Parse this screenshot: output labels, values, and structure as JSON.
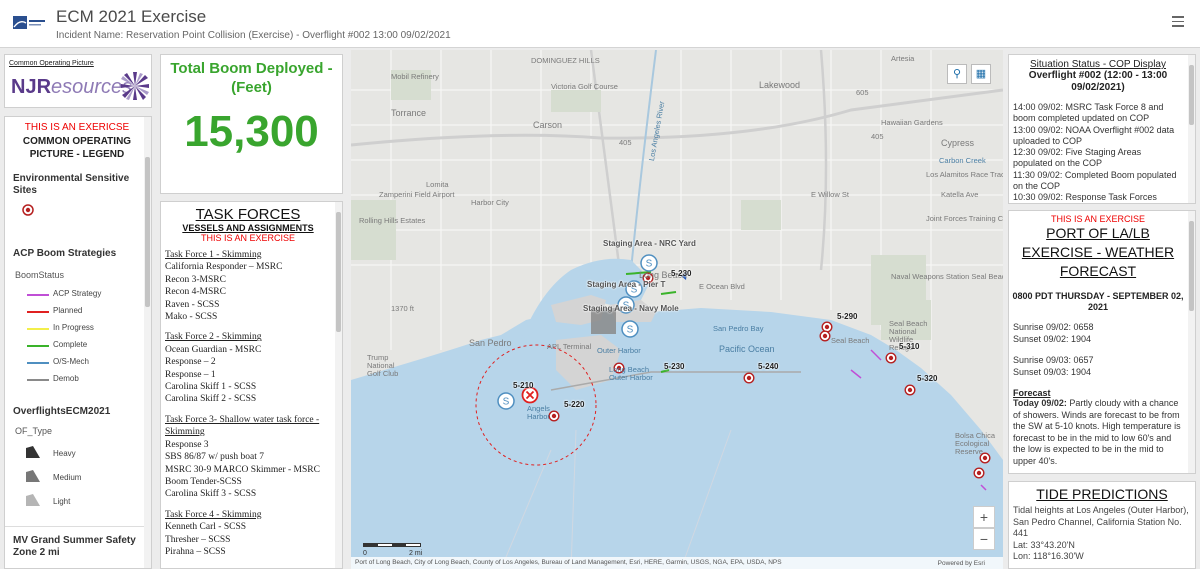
{
  "header": {
    "title": "ECM 2021 Exercise",
    "subtitle": "Incident Name: Reservation Point Collision (Exercise) - Overflight #002 13:00 09/02/2021"
  },
  "logo_panel": {
    "link": "Common Operating Picture",
    "brand_a": "NJR",
    "brand_b": "esources"
  },
  "legend": {
    "exercise_notice": "THIS IS AN EXERICSE",
    "title": "COMMON OPERATING PICTURE - LEGEND",
    "env_header": "Environmental Sensitive Sites",
    "acp_header": "ACP Boom Strategies",
    "boom_status_label": "BoomStatus",
    "boom_items": [
      {
        "label": "ACP Strategy",
        "color": "#c04fd6"
      },
      {
        "label": "Planned",
        "color": "#e02020"
      },
      {
        "label": "In Progress",
        "color": "#f3ef4a"
      },
      {
        "label": "Complete",
        "color": "#3ab32a"
      },
      {
        "label": "O/S-Mech",
        "color": "#4f8fc0"
      },
      {
        "label": "Demob",
        "color": "#8a8a8a"
      }
    ],
    "overflights_header": "OverflightsECM2021",
    "of_type_label": "OF_Type",
    "of_items": [
      {
        "label": "Heavy",
        "color": "#333333"
      },
      {
        "label": "Medium",
        "color": "#777777"
      },
      {
        "label": "Light",
        "color": "#b5b5b5"
      }
    ],
    "mv_header": "MV Grand Summer Safety Zone 2 mi"
  },
  "boom": {
    "title": "Total Boom Deployed - (Feet)",
    "value": "15,300"
  },
  "task_forces": {
    "title": "TASK FORCES",
    "subtitle": "VESSELS AND ASSIGNMENTS",
    "exercise_notice": "THIS IS AN EXERCISE",
    "groups": [
      {
        "name": "Task Force 1 - Skimming",
        "items": [
          "California Responder – MSRC",
          "Recon 3-MSRC",
          "Recon 4-MSRC",
          "Raven - SCSS",
          "Mako - SCSS"
        ]
      },
      {
        "name": "Task Force 2 - Skimming",
        "items": [
          "Ocean Guardian - MSRC",
          "Response – 2",
          "Response – 1",
          "Carolina Skiff 1 - SCSS",
          "Carolina Skiff 2 - SCSS"
        ]
      },
      {
        "name": "Task Force 3- Shallow water task force - Skimming",
        "items": [
          "Response 3",
          "SBS 86/87 w/ push boat 7",
          "MSRC 30-9 MARCO Skimmer - MSRC",
          "Boom Tender-SCSS",
          "Carolina Skiff 3 - SCSS"
        ]
      },
      {
        "name": "Task Force 4 - Skimming",
        "items": [
          "Kenneth Carl - SCSS",
          "Thresher – SCSS",
          "Pirahna – SCSS"
        ]
      }
    ]
  },
  "map": {
    "labels": {
      "dominguez": "DOMINGUEZ HILLS",
      "torrance": "Torrance",
      "mobil": "Mobil Refinery",
      "victoria": "Victoria Golf Course",
      "carson": "Carson",
      "lakewood": "Lakewood",
      "artesia": "Artesia",
      "hawaiian": "Hawaiian Gardens",
      "cypress": "Cypress",
      "carbon": "Carbon Creek",
      "losal": "Los Alamitos Race Track",
      "lomita": "Lomita",
      "zamperini": "Zamperini Field Airport",
      "harborcity": "Harbor City",
      "rolling": "Rolling Hills Estates",
      "jftc": "Joint Forces Training Center",
      "naval": "Naval Weapons Station Seal Beach",
      "sanpedro": "San Pedro",
      "apl": "APL Terminal",
      "outer": "Outer Harbor",
      "sanpedrobay": "San Pedro Bay",
      "pacific": "Pacific Ocean",
      "lbouter": "Long Beach Outer Harbor",
      "angels": "Angels Harbor",
      "sealbeach": "Seal Beach",
      "sealbeachnwr": "Seal Beach National Wildlife Refuge",
      "trump": "Trump National Golf Club",
      "bolsa": "Bolsa Chica Ecological Reserve",
      "longbeach": "Long Beach",
      "eoceanblvd": "E Ocean Blvd",
      "willowst": "E Willow St",
      "katella": "Katella Ave",
      "hwy405": "405",
      "hwy405b": "405",
      "hwy605": "605",
      "lariver": "Los Angeles River",
      "elev": "1370 ft"
    },
    "staging": [
      "Staging Area - NRC Yard",
      "Staging Area - Pier T",
      "Staging Area - Navy Mole"
    ],
    "zones": [
      "5-230",
      "5-210",
      "5-220",
      "5-230",
      "5-240",
      "5-290",
      "5-310",
      "5-320"
    ],
    "scale_zero": "0",
    "scale_label": "2 mi",
    "attribution": "Port of Long Beach, City of Long Beach, County of Los Angeles, Bureau of Land Management, Esri, HERE, Garmin, USGS, NGA, EPA, USDA, NPS",
    "powered": "Powered by Esri",
    "search_icon": "search-icon",
    "qr_icon": "qr-icon",
    "zoom_in": "+",
    "zoom_out": "−",
    "colors": {
      "water": "#b7d5ea",
      "land": "#e6e6e3",
      "harbor": "#d4d4d4",
      "sensitive": "#b52020"
    }
  },
  "situation": {
    "title": "Situation Status - COP Display",
    "subtitle": "Overflight #002 (12:00 - 13:00 09/02/2021)",
    "entries": [
      "14:00 09/02: MSRC Task Force 8 and boom completed updated on COP",
      "13:00 09/02: NOAA Overflight #002 data uploaded to COP",
      "12:30 09/02: Five Staging Areas populated on the COP",
      "11:30 09/02: Completed Boom populated on the COP",
      "10:30 09/02: Response Task Forces"
    ]
  },
  "weather": {
    "exercise_notice": "THIS IS AN EXERCISE",
    "title": "PORT OF LA/LB EXERCISE - WEATHER FORECAST",
    "date": "0800 PDT THURSDAY - SEPTEMBER 02, 2021",
    "sunrise1": "Sunrise 09/02: 0658",
    "sunset1": "Sunset 09/02: 1904",
    "sunrise2": "Sunrise 09/03: 0657",
    "sunset2": "Sunset 09/03: 1904",
    "forecast_header": "Forecast",
    "forecast_day": "Today 09/02:",
    "forecast_text": "Partly cloudy with a chance of showers. Winds are forecast to be from the SW at 5-10 knots. High temperature is forecast to be in the mid to low 60's and the low is expected to be in the mid to upper 40's."
  },
  "tides": {
    "title": "TIDE PREDICTIONS",
    "desc": "Tidal heights at Los Angeles (Outer Harbor), San Pedro Channel, California Station No. 441",
    "lat": "Lat: 33°43.20'N",
    "lon": "Lon: 118°16.30'W"
  }
}
